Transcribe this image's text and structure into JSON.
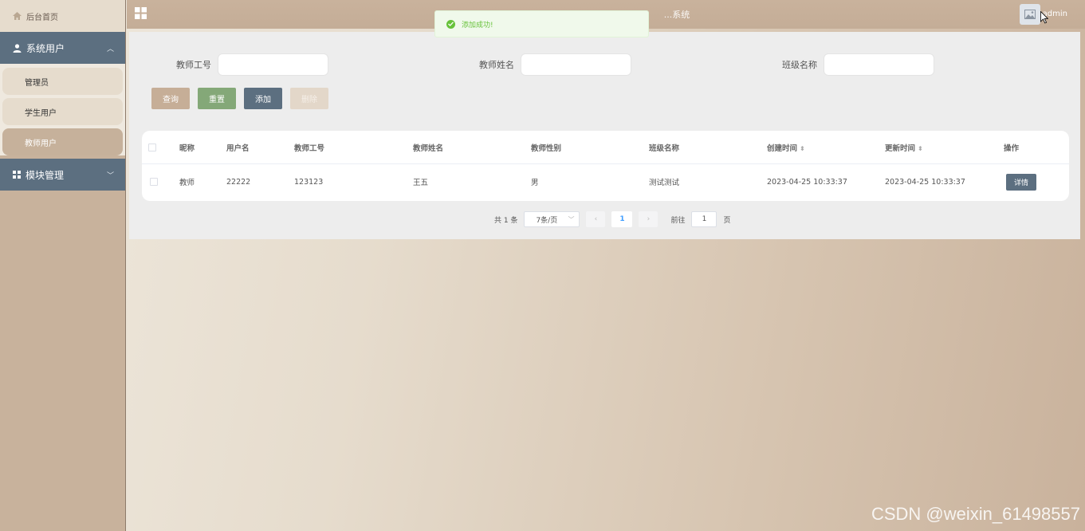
{
  "sidebar": {
    "home": "后台首页",
    "groups": [
      {
        "label": "系统用户",
        "items": [
          "管理员",
          "学生用户",
          "教师用户"
        ],
        "active": "教师用户"
      },
      {
        "label": "模块管理"
      }
    ]
  },
  "header": {
    "title": "...系统",
    "user": "admin"
  },
  "toast": {
    "message": "添加成功!"
  },
  "search": {
    "fields": [
      {
        "label": "教师工号",
        "value": ""
      },
      {
        "label": "教师姓名",
        "value": ""
      },
      {
        "label": "班级名称",
        "value": ""
      }
    ],
    "buttons": {
      "query": "查询",
      "reset": "重置",
      "add": "添加",
      "delete": "删除"
    }
  },
  "table": {
    "columns": [
      "昵称",
      "用户名",
      "教师工号",
      "教师姓名",
      "教师性别",
      "班级名称",
      "创建时间",
      "更新时间",
      "操作"
    ],
    "rows": [
      {
        "nickname": "教师",
        "username": "22222",
        "teacher_no": "123123",
        "teacher_name": "王五",
        "gender": "男",
        "class_name": "测试测试",
        "created": "2023-04-25 10:33:37",
        "updated": "2023-04-25 10:33:37",
        "action": "详情"
      }
    ]
  },
  "pagination": {
    "total": "共 1 条",
    "page_size": "7条/页",
    "current": "1",
    "goto_label": "前往",
    "goto_value": "1",
    "page_suffix": "页"
  },
  "watermark": "CSDN @weixin_61498557",
  "colors": {
    "accent": "#5c6f80",
    "sand": "#c8b29c",
    "success": "#67c23a",
    "reset": "#84a878"
  }
}
